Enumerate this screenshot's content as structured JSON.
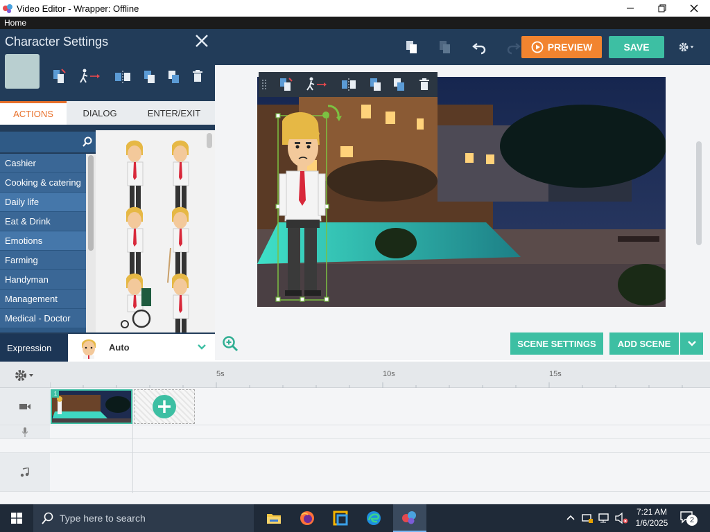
{
  "window": {
    "title": "Video Editor - Wrapper: Offline",
    "menu_home": "Home"
  },
  "toolbar": {
    "preview_label": "PREVIEW",
    "save_label": "SAVE"
  },
  "panel": {
    "title": "Character Settings",
    "tabs": [
      {
        "label": "ACTIONS"
      },
      {
        "label": "DIALOG"
      },
      {
        "label": "ENTER/EXIT"
      }
    ],
    "categories": [
      {
        "label": "Cashier"
      },
      {
        "label": "Cooking & catering"
      },
      {
        "label": "Daily life"
      },
      {
        "label": "Eat & Drink"
      },
      {
        "label": "Emotions"
      },
      {
        "label": "Farming"
      },
      {
        "label": "Handyman"
      },
      {
        "label": "Management"
      },
      {
        "label": "Medical - Doctor"
      }
    ],
    "expression_label": "Expression",
    "expression_value": "Auto"
  },
  "stage": {
    "scene_settings_label": "SCENE SETTINGS",
    "add_scene_label": "ADD SCENE"
  },
  "timeline": {
    "ticks": [
      "5s",
      "10s",
      "15s"
    ],
    "scene_number": "1"
  },
  "taskbar": {
    "search_placeholder": "Type here to search",
    "time": "7:21 AM",
    "date": "1/6/2025",
    "notification_count": "2"
  },
  "colors": {
    "accent_green": "#3dbfa3",
    "accent_orange": "#f2842f",
    "panel_navy": "#223c59"
  }
}
